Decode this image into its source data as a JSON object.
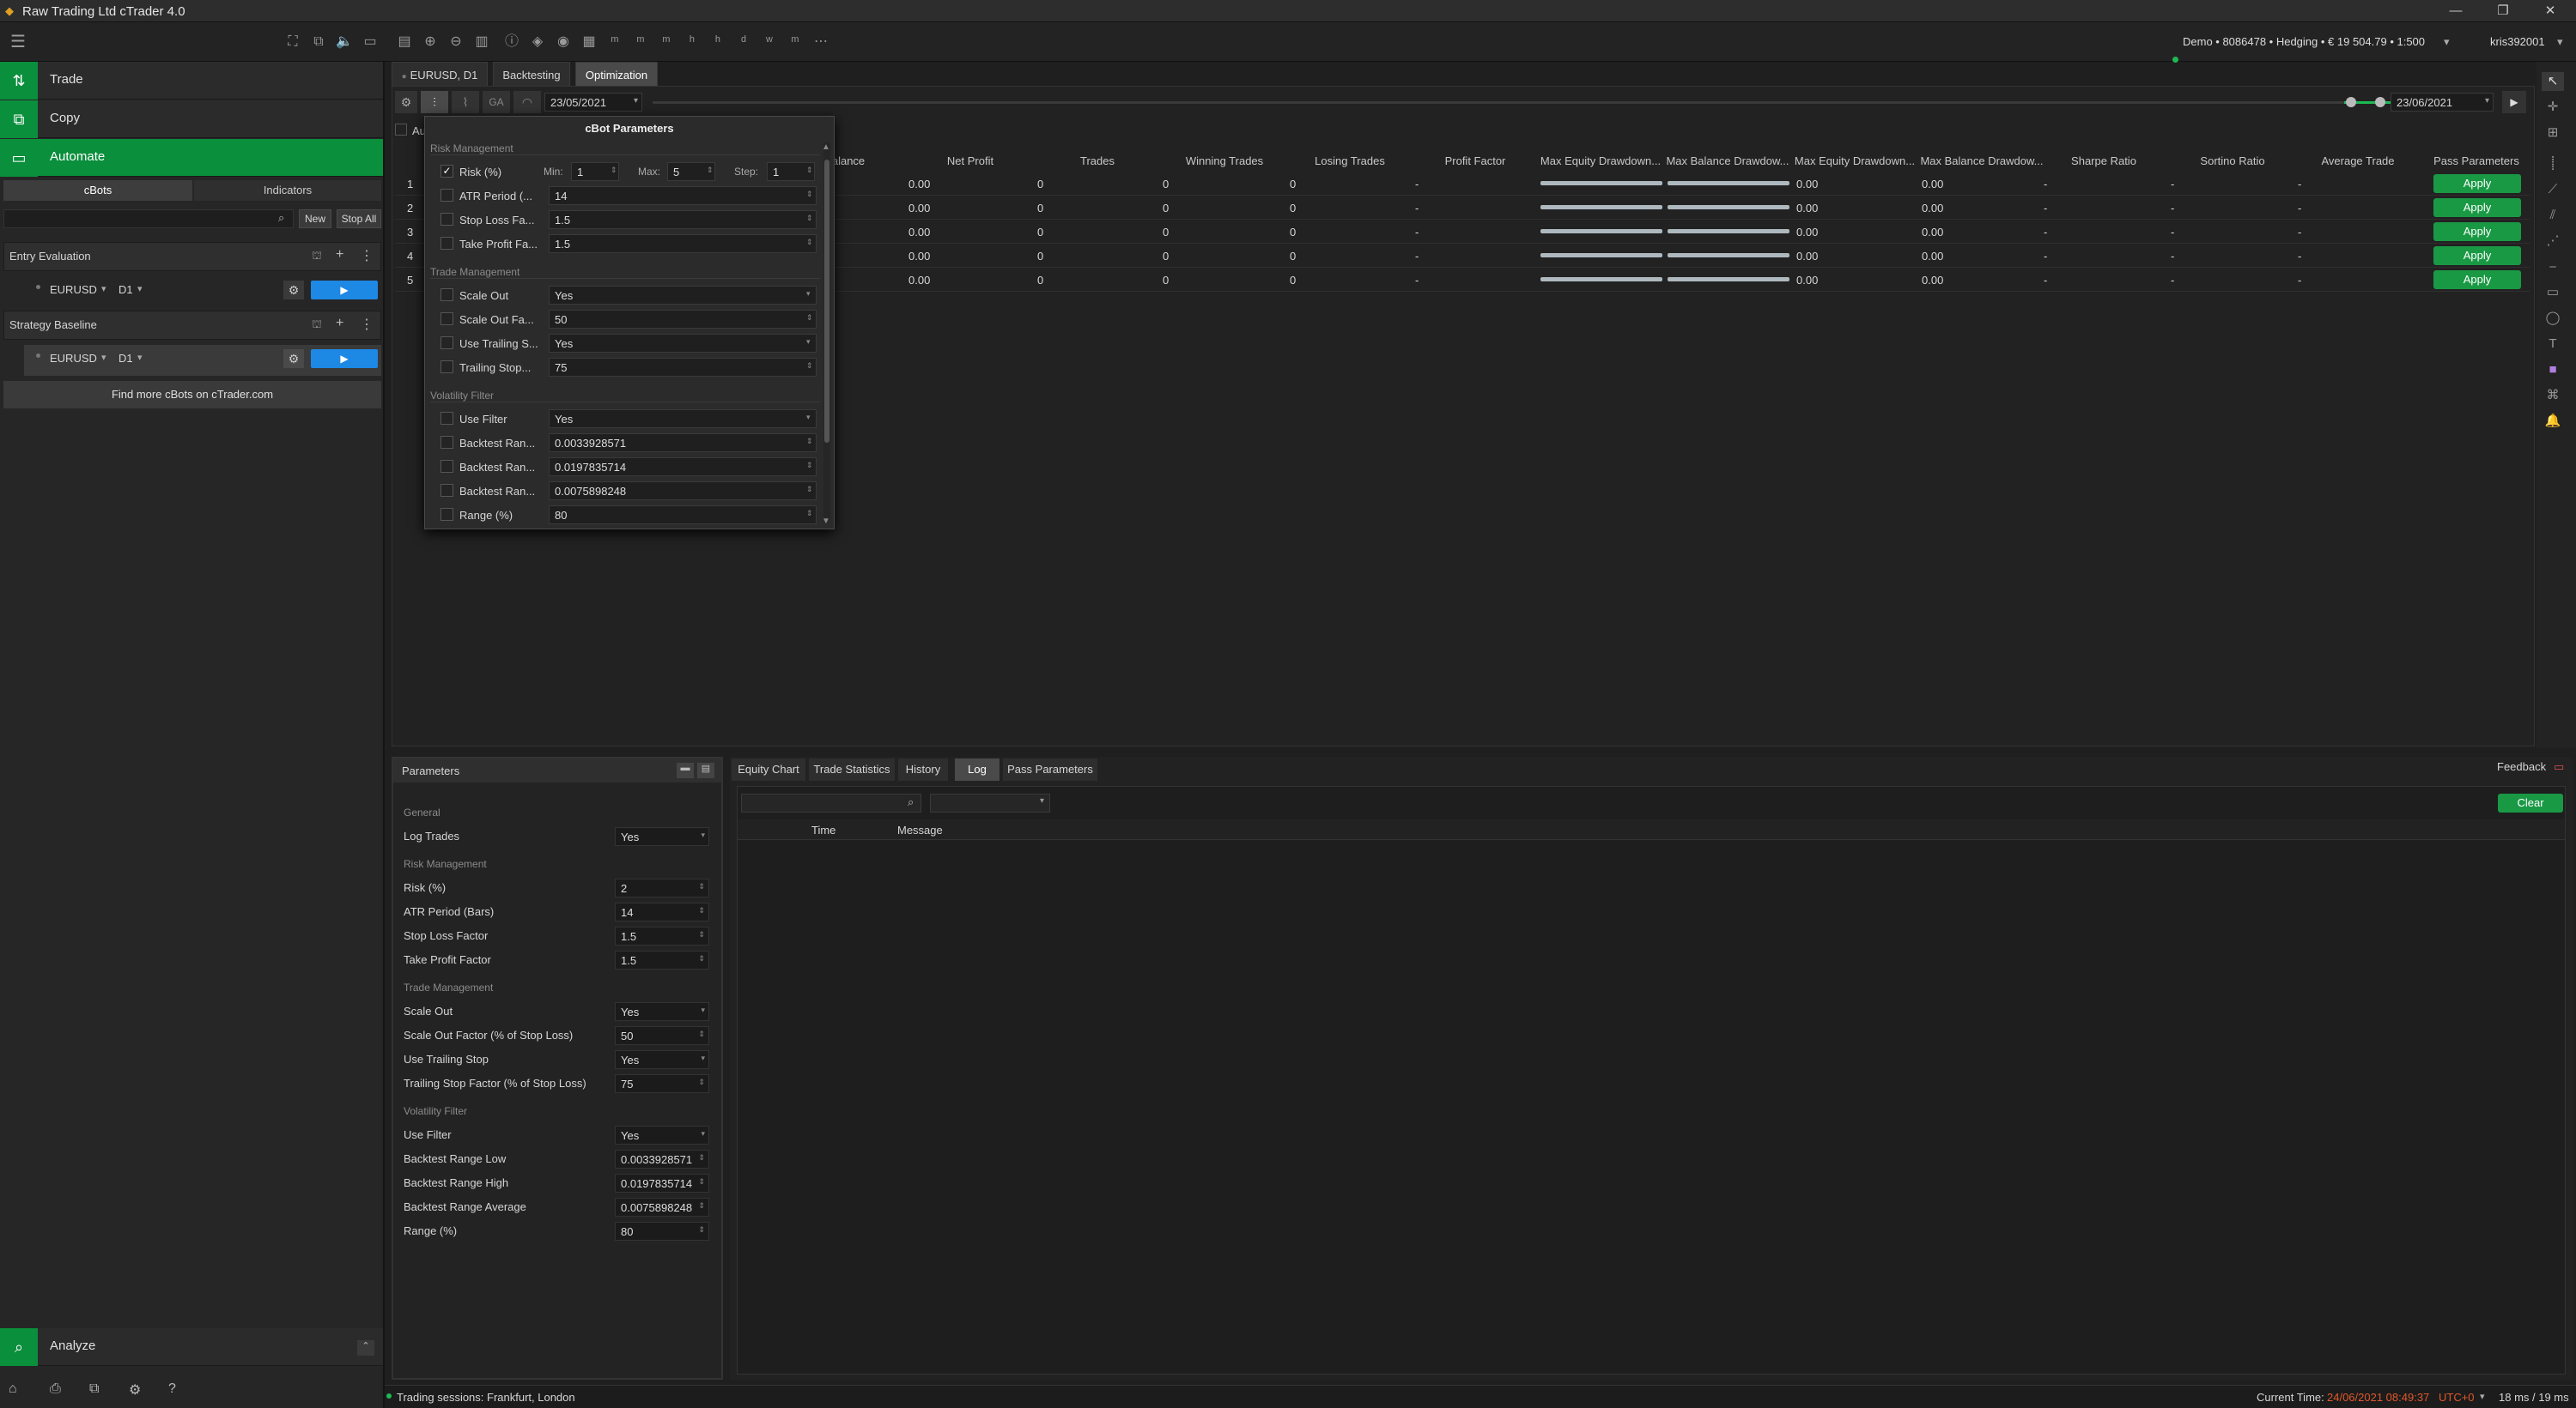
{
  "window": {
    "title": "Raw Trading Ltd cTrader 4.0"
  },
  "account": {
    "summary": "Demo • 8086478 • Hedging • € 19 504.79 • 1:500",
    "user": "kris392001"
  },
  "nav": {
    "trade": "Trade",
    "copy": "Copy",
    "automate": "Automate",
    "analyze": "Analyze"
  },
  "subtabs": {
    "cbots": "cBots",
    "indicators": "Indicators"
  },
  "cbots_toolbar": {
    "new": "New",
    "stop_all": "Stop All"
  },
  "bots": [
    {
      "name": "Entry Evaluation",
      "symbol": "EURUSD",
      "tf": "D1"
    },
    {
      "name": "Strategy Baseline",
      "symbol": "EURUSD",
      "tf": "D1"
    }
  ],
  "find_more": "Find more cBots on cTrader.com",
  "tabs": {
    "chart": "EURUSD, D1",
    "backtesting": "Backtesting",
    "optimization": "Optimization"
  },
  "dates": {
    "start": "23/05/2021",
    "end": "23/06/2021"
  },
  "grid": {
    "headers": [
      "alance",
      "Net Profit",
      "Trades",
      "Winning Trades",
      "Losing Trades",
      "Profit Factor",
      "Max Equity Drawdown...",
      "Max Balance Drawdow...",
      "Max Equity Drawdown...",
      "Max Balance Drawdow...",
      "Sharpe Ratio",
      "Sortino Ratio",
      "Average Trade",
      "Pass Parameters"
    ],
    "rows": [
      {
        "n": "1",
        "net": "0.00",
        "trades": "0",
        "win": "0",
        "lose": "0",
        "pf": "-",
        "med": "0.00",
        "mbd": "0.00",
        "sharpe": "-",
        "sortino": "-",
        "avg": "-"
      },
      {
        "n": "2",
        "net": "0.00",
        "trades": "0",
        "win": "0",
        "lose": "0",
        "pf": "-",
        "med": "0.00",
        "mbd": "0.00",
        "sharpe": "-",
        "sortino": "-",
        "avg": "-"
      },
      {
        "n": "3",
        "net": "0.00",
        "trades": "0",
        "win": "0",
        "lose": "0",
        "pf": "-",
        "med": "0.00",
        "mbd": "0.00",
        "sharpe": "-",
        "sortino": "-",
        "avg": "-"
      },
      {
        "n": "4",
        "net": "0.00",
        "trades": "0",
        "win": "0",
        "lose": "0",
        "pf": "-",
        "med": "0.00",
        "mbd": "0.00",
        "sharpe": "-",
        "sortino": "-",
        "avg": "-"
      },
      {
        "n": "5",
        "net": "0.00",
        "trades": "0",
        "win": "0",
        "lose": "0",
        "pf": "-",
        "med": "0.00",
        "mbd": "0.00",
        "sharpe": "-",
        "sortino": "-",
        "avg": "-"
      }
    ],
    "apply": "Apply",
    "au": "Au"
  },
  "popup": {
    "title": "cBot Parameters",
    "risk_section": "Risk Management",
    "risk": {
      "label": "Risk (%)",
      "min_label": "Min:",
      "min": "1",
      "max_label": "Max:",
      "max": "5",
      "step_label": "Step:",
      "step": "1"
    },
    "atr": {
      "label": "ATR Period (...",
      "value": "14"
    },
    "sl": {
      "label": "Stop Loss Fa...",
      "value": "1.5"
    },
    "tp": {
      "label": "Take Profit Fa...",
      "value": "1.5"
    },
    "trade_section": "Trade Management",
    "scale_out": {
      "label": "Scale Out",
      "value": "Yes"
    },
    "scale_out_f": {
      "label": "Scale Out Fa...",
      "value": "50"
    },
    "use_trail": {
      "label": "Use Trailing S...",
      "value": "Yes"
    },
    "trail_f": {
      "label": "Trailing Stop...",
      "value": "75"
    },
    "vol_section": "Volatility Filter",
    "use_filter": {
      "label": "Use Filter",
      "value": "Yes"
    },
    "br1": {
      "label": "Backtest Ran...",
      "value": "0.0033928571"
    },
    "br2": {
      "label": "Backtest Ran...",
      "value": "0.0197835714"
    },
    "br3": {
      "label": "Backtest Ran...",
      "value": "0.0075898248"
    },
    "range": {
      "label": "Range (%)",
      "value": "80"
    }
  },
  "params": {
    "title": "Parameters",
    "general": "General",
    "log_trades": {
      "label": "Log Trades",
      "value": "Yes"
    },
    "risk_section": "Risk Management",
    "risk": {
      "label": "Risk (%)",
      "value": "2"
    },
    "atr": {
      "label": "ATR Period (Bars)",
      "value": "14"
    },
    "sl": {
      "label": "Stop Loss Factor",
      "value": "1.5"
    },
    "tp": {
      "label": "Take Profit Factor",
      "value": "1.5"
    },
    "trade_section": "Trade Management",
    "scale_out": {
      "label": "Scale Out",
      "value": "Yes"
    },
    "scale_out_f": {
      "label": "Scale Out Factor (% of Stop Loss)",
      "value": "50"
    },
    "use_trail": {
      "label": "Use Trailing Stop",
      "value": "Yes"
    },
    "trail_f": {
      "label": "Trailing Stop Factor (% of Stop Loss)",
      "value": "75"
    },
    "vol_section": "Volatility Filter",
    "use_filter": {
      "label": "Use Filter",
      "value": "Yes"
    },
    "brl": {
      "label": "Backtest Range Low",
      "value": "0.0033928571"
    },
    "brh": {
      "label": "Backtest Range High",
      "value": "0.0197835714"
    },
    "bra": {
      "label": "Backtest Range Average",
      "value": "0.0075898248"
    },
    "range": {
      "label": "Range (%)",
      "value": "80"
    }
  },
  "logtabs": {
    "equity": "Equity Chart",
    "stats": "Trade Statistics",
    "history": "History",
    "log": "Log",
    "pass": "Pass Parameters"
  },
  "log": {
    "feedback": "Feedback",
    "clear": "Clear",
    "col_time": "Time",
    "col_msg": "Message"
  },
  "status": {
    "sessions": "Trading sessions: Frankfurt, London",
    "current_label": "Current Time:",
    "current_time": "24/06/2021 08:49:37",
    "tz": "UTC+0",
    "latency": "18 ms / 19 ms"
  }
}
